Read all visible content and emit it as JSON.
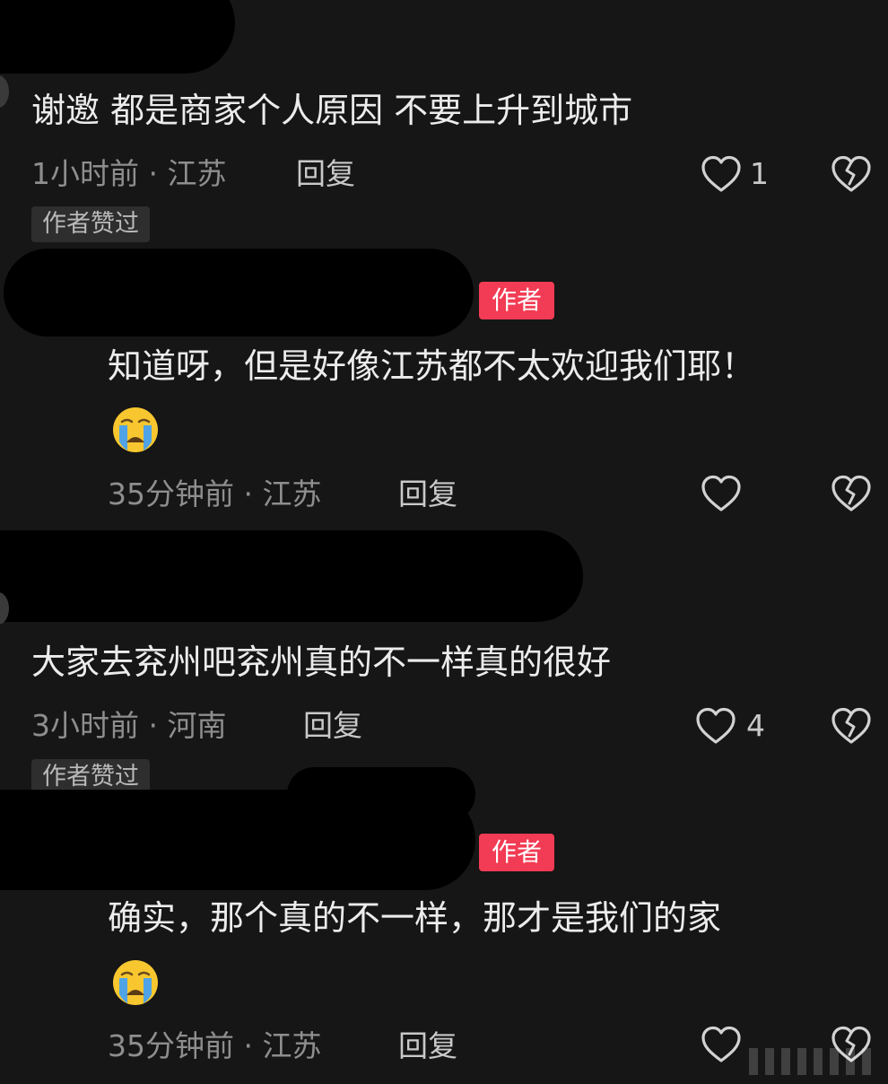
{
  "comments": [
    {
      "text": "谢邀 都是商家个人原因 不要上升到城市",
      "meta": "1小时前 · 江苏",
      "reply": "回复",
      "like_count": "1",
      "badge": "作者赞过"
    },
    {
      "author_badge": "作者",
      "text": "知道呀，但是好像江苏都不太欢迎我们耶！",
      "emoji": "loudly-crying-face",
      "meta": "35分钟前 · 江苏",
      "reply": "回复",
      "like_count": ""
    },
    {
      "text": "大家去兖州吧兖州真的不一样真的很好",
      "meta": "3小时前 · 河南",
      "reply": "回复",
      "like_count": "4",
      "badge": "作者赞过"
    },
    {
      "author_badge": "作者",
      "text": "确实，那个真的不一样，那才是我们的家",
      "emoji": "loudly-crying-face",
      "meta": "35分钟前 · 江苏",
      "reply": "回复",
      "like_count": ""
    }
  ],
  "icons": {
    "like": "heart-outline-icon",
    "dislike": "broken-heart-outline-icon"
  },
  "colors": {
    "background": "#161616",
    "author_badge": "#f23b54",
    "text": "#ececec",
    "meta": "#8e8e8e"
  }
}
